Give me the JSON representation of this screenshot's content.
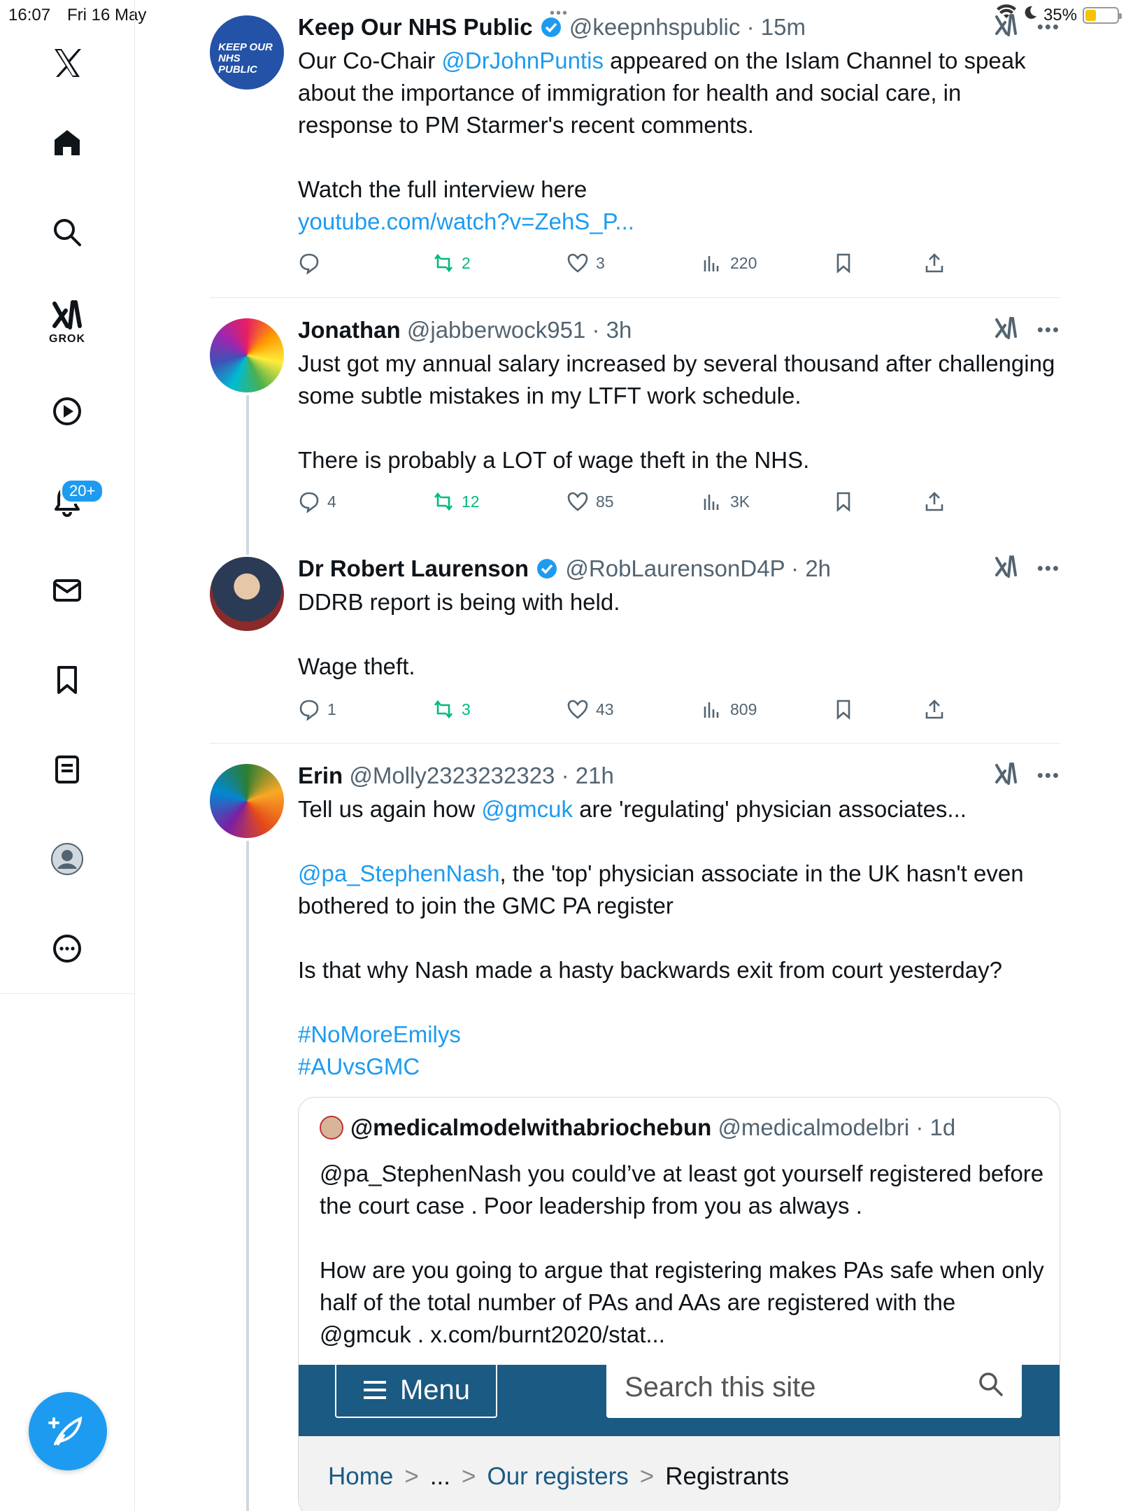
{
  "status_bar": {
    "time": "16:07",
    "date": "Fri 16 May",
    "battery": "35%",
    "battery_level": 0.35
  },
  "sidebar": {
    "grok_label": "GROK",
    "notification_badge": "20+",
    "items": [
      "x-logo",
      "home",
      "search",
      "grok",
      "video",
      "notifications",
      "messages",
      "bookmarks",
      "lists",
      "profile",
      "more"
    ]
  },
  "colors": {
    "accent": "#1d9bf0",
    "retweet": "#00ba7c",
    "muted": "#536471"
  },
  "tweets": [
    {
      "name": "Keep Our NHS Public",
      "handle": "@keepnhspublic",
      "time": "15m",
      "avatar_text": "KEEP OUR NHS PUBLIC",
      "text_pre": "Our Co-Chair ",
      "mention": "@DrJohnPuntis",
      "text_post": " appeared on the Islam Channel to speak about the importance of immigration for health and social care, in response to PM Starmer's recent comments.\n\nWatch the full interview here",
      "link": "youtube.com/watch?v=ZehS_P...",
      "replies": "",
      "retweets": "2",
      "likes": "3",
      "views": "220"
    },
    {
      "name": "Jonathan",
      "handle": "@jabberwock951",
      "time": "3h",
      "text": "Just got my annual salary increased by several thousand after challenging some subtle mistakes in my LTFT work schedule.\n\nThere is probably a LOT of wage theft in the NHS.",
      "replies": "4",
      "retweets": "12",
      "likes": "85",
      "views": "3K"
    },
    {
      "name": "Dr Robert Laurenson",
      "handle": "@RobLaurensonD4P",
      "time": "2h",
      "text": "DDRB report is being with held.\n\nWage theft.",
      "replies": "1",
      "retweets": "3",
      "likes": "43",
      "views": "809"
    },
    {
      "name": "Erin",
      "handle": "@Molly2323232323",
      "time": "21h",
      "line1_pre": "Tell us again how ",
      "line1_mention": "@gmcuk",
      "line1_post": " are 'regulating' physician associates...",
      "para2_mention": "@pa_StephenNash",
      "para2_post": ", the 'top' physician associate in the UK hasn't even bothered to join the GMC PA register",
      "para3": "Is that why Nash made a hasty backwards exit from court yesterday?",
      "hashtag1": "#NoMoreEmilys",
      "hashtag2": "#AUvsGMC",
      "quote": {
        "name": "@medicalmodelwithabriochebun",
        "handle": "@medicalmodelbri",
        "time": "1d",
        "text": "@pa_StephenNash you could’ve at least got yourself registered before the court case . Poor leadership from you as always .\n\nHow are you going to argue that registering makes PAs safe when only  half of the total number of PAs and AAs are registered with the @gmcuk . x.com/burnt2020/stat...",
        "image": {
          "menu_label": "Menu",
          "search_placeholder": "Search this site",
          "crumb_home": "Home",
          "crumb_ellipsis": "...",
          "crumb_registers": "Our registers",
          "crumb_current": "Registrants"
        }
      }
    }
  ]
}
